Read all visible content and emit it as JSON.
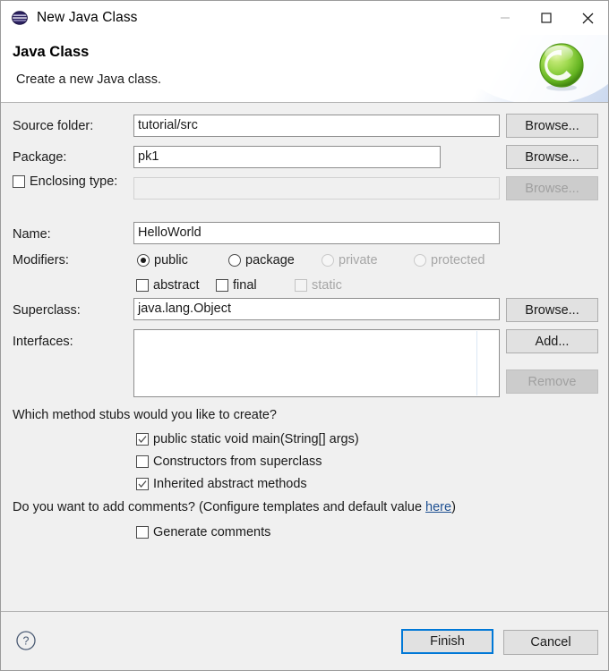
{
  "window": {
    "title": "New Java Class",
    "icon": "eclipse-logo-icon",
    "minimize_label": "Minimize",
    "maximize_label": "Maximize",
    "close_label": "Close"
  },
  "banner": {
    "title": "Java Class",
    "subtitle": "Create a new Java class.",
    "logo_letter": "C",
    "logo_color": "#7ac943"
  },
  "form": {
    "source_folder": {
      "label": "Source folder:",
      "value": "tutorial/src",
      "browse_label": "Browse..."
    },
    "package": {
      "label": "Package:",
      "value": "pk1",
      "placeholder": "",
      "browse_label": "Browse..."
    },
    "enclosing_type": {
      "label": "Enclosing type:",
      "checked": false,
      "value": "",
      "browse_label": "Browse...",
      "enabled": false
    },
    "name": {
      "label": "Name:",
      "value": "HelloWorld"
    },
    "modifiers": {
      "label": "Modifiers:",
      "access": [
        {
          "label": "public",
          "selected": true,
          "enabled": true
        },
        {
          "label": "package",
          "selected": false,
          "enabled": true
        },
        {
          "label": "private",
          "selected": false,
          "enabled": false
        },
        {
          "label": "protected",
          "selected": false,
          "enabled": false
        }
      ],
      "flags": [
        {
          "label": "abstract",
          "checked": false,
          "enabled": true
        },
        {
          "label": "final",
          "checked": false,
          "enabled": true
        },
        {
          "label": "static",
          "checked": false,
          "enabled": false
        }
      ]
    },
    "superclass": {
      "label": "Superclass:",
      "value": "java.lang.Object",
      "browse_label": "Browse..."
    },
    "interfaces": {
      "label": "Interfaces:",
      "items": [],
      "add_label": "Add...",
      "remove_label": "Remove",
      "remove_enabled": false
    }
  },
  "stubs": {
    "question": "Which method stubs would you like to create?",
    "options": [
      {
        "label": "public static void main(String[] args)",
        "checked": true
      },
      {
        "label": "Constructors from superclass",
        "checked": false
      },
      {
        "label": "Inherited abstract methods",
        "checked": true
      }
    ]
  },
  "comments": {
    "question_prefix": "Do you want to add comments? (Configure templates and default value ",
    "link_label": "here",
    "question_suffix": ")",
    "option": {
      "label": "Generate comments",
      "checked": false
    }
  },
  "footer": {
    "help_label": "?",
    "finish_label": "Finish",
    "cancel_label": "Cancel"
  }
}
